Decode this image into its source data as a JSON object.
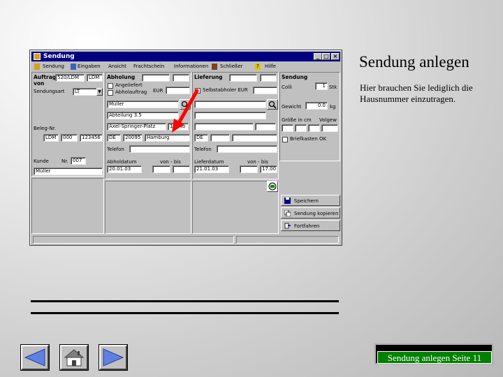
{
  "slide": {
    "title": "Sendung anlegen",
    "description": "Hier brauchen Sie lediglich die Hausnummer einzutragen.",
    "page_label": "Sendung anlegen Seite 11"
  },
  "window": {
    "title": "Sendung",
    "menu": [
      "Sendung",
      "Eingaben",
      "Ansicht",
      "Frachtschein",
      "Informationen",
      "Schließer",
      "Hilfe"
    ]
  },
  "auftrag": {
    "label": "Auftrag",
    "von_label": "von",
    "field1": "520/LDM",
    "field2": "LDM",
    "sendungsart_label": "Sendungsart",
    "sendungsart_value": "LT",
    "beleg_label": "Beleg-Nr.",
    "beleg_a": "LDM",
    "beleg_b": "000",
    "beleg_c": "123456",
    "kunde_label": "Kunde",
    "nr_label": "Nr.",
    "kunde_nr": "007",
    "kunde_name": "Müller"
  },
  "abholung": {
    "label": "Abholung",
    "angeliefert_label": "Angeliefert",
    "abholauftrag_label": "Abholauftrag",
    "eur_label": "EUR",
    "name": "Müller",
    "abteilung": "Abteilung 3.5",
    "street": "Axel-Springer-Platz",
    "house_number": "1024b",
    "country": "DE",
    "plz": "20095",
    "city": "Hamburg",
    "telefon_label": "Telefon",
    "datum_label": "Abholdatum",
    "von_bis_label": "von - bis",
    "datum": "20.01.03"
  },
  "lieferung": {
    "label": "Lieferung",
    "selbstabholer_label": "Selbstabholer EUR",
    "country": "DE",
    "telefon_label": "Telefon",
    "datum_label": "Lieferdatum",
    "von_bis_label": "von - bis",
    "datum": "21.01.03",
    "bis": "17.00"
  },
  "sendung_panel": {
    "label": "Sendung",
    "colli_label": "Colli",
    "colli_value": "1",
    "stk_label": "Stk",
    "gewicht_label": "Gewicht",
    "gewicht_value": "0.0",
    "kg_label": "kg",
    "groesse_label": "Größe in cm",
    "volgew_label": "Volgew",
    "briefkasten_label": "Briefkasten OK"
  },
  "buttons": {
    "speichern": "Speichern",
    "kopieren": "Sendung kopieren",
    "fortfahren": "Fortfahren"
  },
  "colors": {
    "titlebar": "#000080",
    "window_bg": "#c0c0c0",
    "arrow": "#ff0000",
    "page_box": "#008000"
  }
}
